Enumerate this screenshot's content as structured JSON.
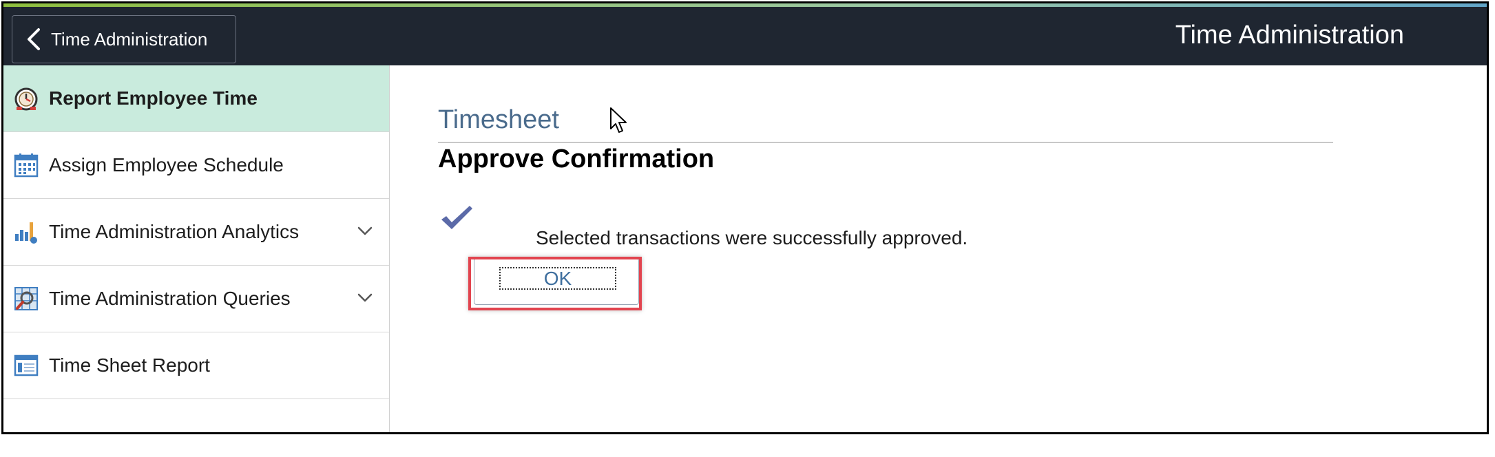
{
  "header": {
    "back_label": "Time Administration",
    "title": "Time Administration",
    "back_icon": "chevron-left-icon"
  },
  "sidebar": {
    "items": [
      {
        "label": "Report Employee Time",
        "icon": "clock-icon",
        "active": true,
        "expandable": false
      },
      {
        "label": "Assign Employee Schedule",
        "icon": "calendar-icon",
        "active": false,
        "expandable": false
      },
      {
        "label": "Time Administration Analytics",
        "icon": "bar-chart-icon",
        "active": false,
        "expandable": true
      },
      {
        "label": "Time Administration Queries",
        "icon": "query-icon",
        "active": false,
        "expandable": true
      },
      {
        "label": "Time Sheet Report",
        "icon": "report-icon",
        "active": false,
        "expandable": false
      }
    ]
  },
  "main": {
    "section_title": "Timesheet",
    "heading": "Approve Confirmation",
    "message": "Selected transactions were successfully approved.",
    "ok_label": "OK"
  },
  "colors": {
    "header_bg": "#1f2631",
    "active_item_bg": "#c9ebdd",
    "section_title": "#4a6b8c",
    "highlight_border": "#e2444f",
    "check": "#5b6aa8"
  }
}
